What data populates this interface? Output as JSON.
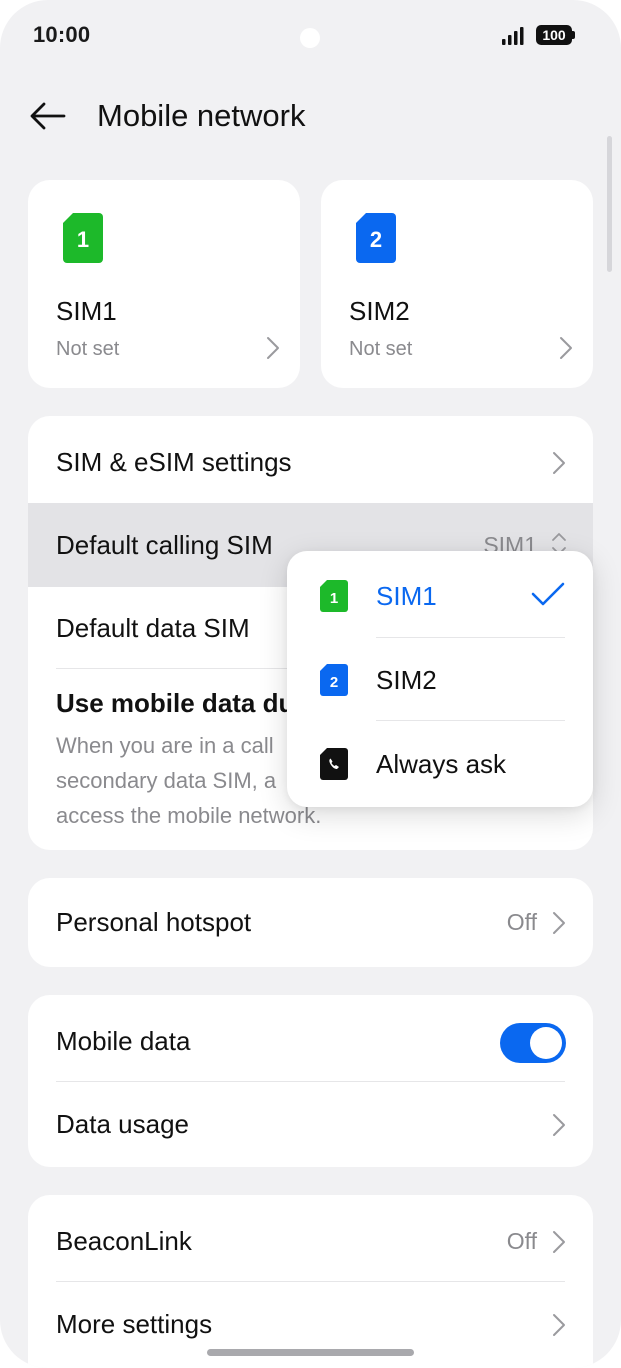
{
  "status_bar": {
    "time": "10:00",
    "battery": "100"
  },
  "header": {
    "title": "Mobile network"
  },
  "sims": [
    {
      "badge": "1",
      "name": "SIM1",
      "status": "Not set",
      "color": "#1db92a"
    },
    {
      "badge": "2",
      "name": "SIM2",
      "status": "Not set",
      "color": "#0a68f0"
    }
  ],
  "sim_settings": {
    "sim_esim_label": "SIM & eSIM settings",
    "default_calling_label": "Default calling SIM",
    "default_calling_value": "SIM1",
    "default_data_label": "Default data SIM",
    "use_data_title": "Use mobile data du",
    "use_data_desc_1": "When you are in a call",
    "use_data_desc_2": "secondary data SIM, a",
    "use_data_desc_3": "access the mobile network."
  },
  "hotspot": {
    "label": "Personal hotspot",
    "value": "Off"
  },
  "data": {
    "mobile_data_label": "Mobile data",
    "mobile_data_on": true,
    "data_usage_label": "Data usage"
  },
  "more": {
    "beaconlink_label": "BeaconLink",
    "beaconlink_value": "Off",
    "more_settings_label": "More settings"
  },
  "popup": {
    "options": [
      {
        "badge": "1",
        "label": "SIM1",
        "selected": true,
        "color": "#1db92a"
      },
      {
        "badge": "2",
        "label": "SIM2",
        "selected": false,
        "color": "#0a68f0"
      },
      {
        "badge": "",
        "label": "Always ask",
        "selected": false,
        "color": "#111111",
        "icon": "phone-sim-icon"
      }
    ]
  },
  "colors": {
    "accent": "#0a68f0",
    "sim1": "#1db92a",
    "sim2": "#0a68f0",
    "background": "#f1f1f3"
  }
}
